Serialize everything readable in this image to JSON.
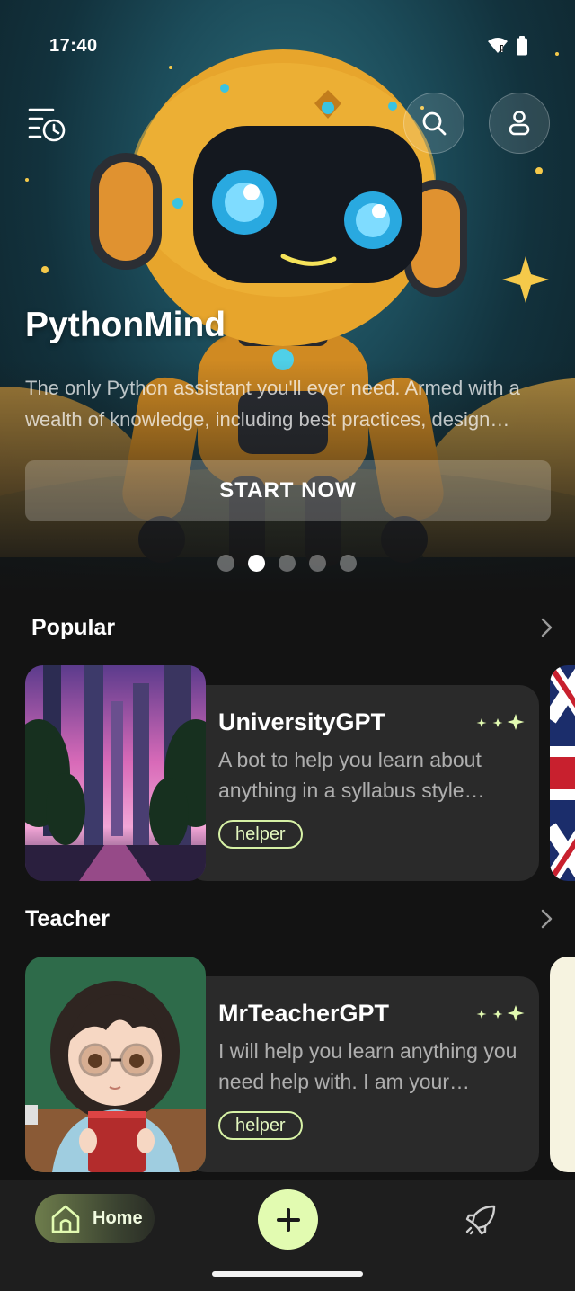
{
  "status_bar": {
    "time": "17:40"
  },
  "hero": {
    "title": "PythonMind",
    "description": "The only Python assistant you'll ever need. Armed with a wealth of knowledge, including best practices, design patterns and debugging tips.",
    "cta_label": "START NOW",
    "carousel": {
      "count": 5,
      "active_index": 1
    }
  },
  "sections": [
    {
      "title": "Popular",
      "card": {
        "name": "UniversityGPT",
        "description": "A bot to help you learn about anything in a syllabus style format.",
        "tag": "helper"
      }
    },
    {
      "title": "Teacher",
      "card": {
        "name": "MrTeacherGPT",
        "description": "I will help you learn anything you need help with. I am your teacher.",
        "tag": "helper"
      }
    }
  ],
  "bottom_nav": {
    "home_label": "Home",
    "accent_color": "#e2fbb1"
  },
  "icons": {
    "history": "history-icon",
    "search": "search-icon",
    "profile": "profile-icon",
    "sparkle": "sparkle-icon",
    "chevron": "chevron-right-icon",
    "home": "home-icon",
    "add": "plus-icon",
    "explore": "rocket-icon"
  }
}
